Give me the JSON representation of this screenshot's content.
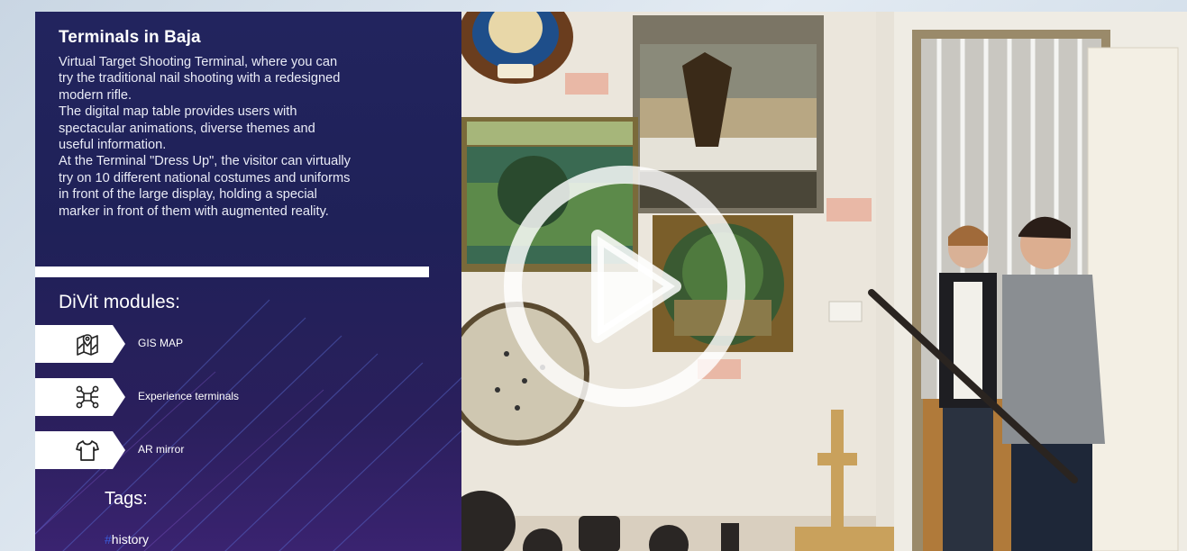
{
  "panel": {
    "title": "Terminals in Baja",
    "description_lines": [
      "Virtual Target Shooting Terminal, where you can",
      "try the traditional nail shooting with a redesigned",
      "modern rifle.",
      "The digital map table provides users with",
      "spectacular animations, diverse themes and",
      "useful information.",
      "At the Terminal \"Dress Up\", the visitor can virtually",
      "try on 10 different national costumes and uniforms",
      "in front of the large display, holding a special",
      "marker in front of them with augmented reality."
    ],
    "modules_heading": "DiVit modules:",
    "modules": [
      {
        "label": "GIS MAP",
        "icon": "map-icon"
      },
      {
        "label": "Experience terminals",
        "icon": "network-icon"
      },
      {
        "label": "AR mirror",
        "icon": "shirt-icon"
      }
    ],
    "tags_heading": "Tags:",
    "tag_hash": "#",
    "tag": "history"
  },
  "video": {
    "play_icon": "play-icon"
  },
  "colors": {
    "panel_background": "#22245e",
    "panel_accent": "#3b5bd9",
    "play_button": "#ffffff"
  }
}
